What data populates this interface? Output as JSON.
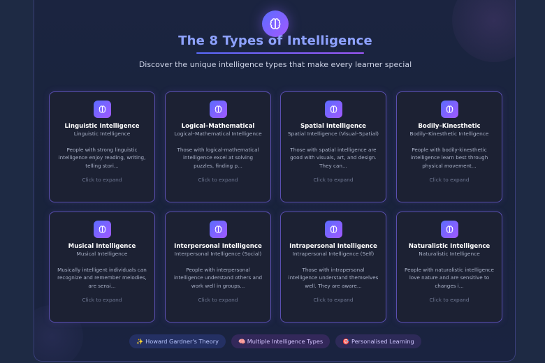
{
  "header": {
    "icon": "brain-icon",
    "title": "The 8 Types of Intelligence",
    "subtitle": "Discover the unique intelligence types that make every learner special"
  },
  "cards": [
    {
      "icon": "brain-icon",
      "title": "Linguistic Intelligence",
      "subtitle": "Linguistic Intelligence",
      "description": "People with strong linguistic intelligence enjoy reading, writing, telling stori...",
      "expand": "Click to expand"
    },
    {
      "icon": "brain-icon",
      "title": "Logical–Mathematical",
      "subtitle": "Logical–Mathematical Intelligence",
      "description": "Those with logical-mathematical intelligence excel at solving puzzles, finding p...",
      "expand": "Click to expand"
    },
    {
      "icon": "brain-icon",
      "title": "Spatial Intelligence",
      "subtitle": "Spatial Intelligence (Visual–Spatial)",
      "description": "Those with spatial intelligence are good with visuals, art, and design. They can...",
      "expand": "Click to expand"
    },
    {
      "icon": "brain-icon",
      "title": "Bodily–Kinesthetic",
      "subtitle": "Bodily–Kinesthetic Intelligence",
      "description": "People with bodily-kinesthetic intelligence learn best through physical movement...",
      "expand": "Click to expand"
    },
    {
      "icon": "brain-icon",
      "title": "Musical Intelligence",
      "subtitle": "Musical Intelligence",
      "description": "Musically intelligent individuals can recognize and remember melodies, are sensi...",
      "expand": "Click to expand"
    },
    {
      "icon": "brain-icon",
      "title": "Interpersonal Intelligence",
      "subtitle": "Interpersonal Intelligence (Social)",
      "description": "People with interpersonal intelligence understand others and work well in groups...",
      "expand": "Click to expand"
    },
    {
      "icon": "brain-icon",
      "title": "Intrapersonal Intelligence",
      "subtitle": "Intrapersonal Intelligence (Self)",
      "description": "Those with intrapersonal intelligence understand themselves well. They are aware...",
      "expand": "Click to expand"
    },
    {
      "icon": "brain-icon",
      "title": "Naturalistic Intelligence",
      "subtitle": "Naturalistic Intelligence",
      "description": "People with naturalistic intelligence love nature and are sensitive to changes i...",
      "expand": "Click to expand"
    }
  ],
  "tags": [
    {
      "label": "✨ Howard Gardner's Theory",
      "color": "#243063"
    },
    {
      "label": "🧠 Multiple Intelligence Types",
      "color": "#33285a"
    },
    {
      "label": "🎯 Personalised Learning",
      "color": "#2d2a58"
    }
  ],
  "colors": {
    "accent_start": "#5b6cff",
    "accent_end": "#a259ff",
    "title": "#8ea2ff",
    "card_border": "#5a4fb0",
    "background": "#1e2a44"
  }
}
